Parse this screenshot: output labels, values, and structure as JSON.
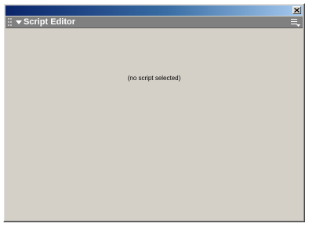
{
  "window": {
    "close_icon": "close-x-icon",
    "colors": {
      "titlebar_start": "#0a246a",
      "titlebar_end": "#a6caf0",
      "panel_header": "#808080",
      "panel_body": "#d4d0c8"
    }
  },
  "panel": {
    "title": "Script Editor",
    "collapse_icon": "triangle-down-icon",
    "grip_icon": "grip-icon",
    "options_icon": "options-menu-icon"
  },
  "editor": {
    "empty_message": "(no script selected)"
  }
}
